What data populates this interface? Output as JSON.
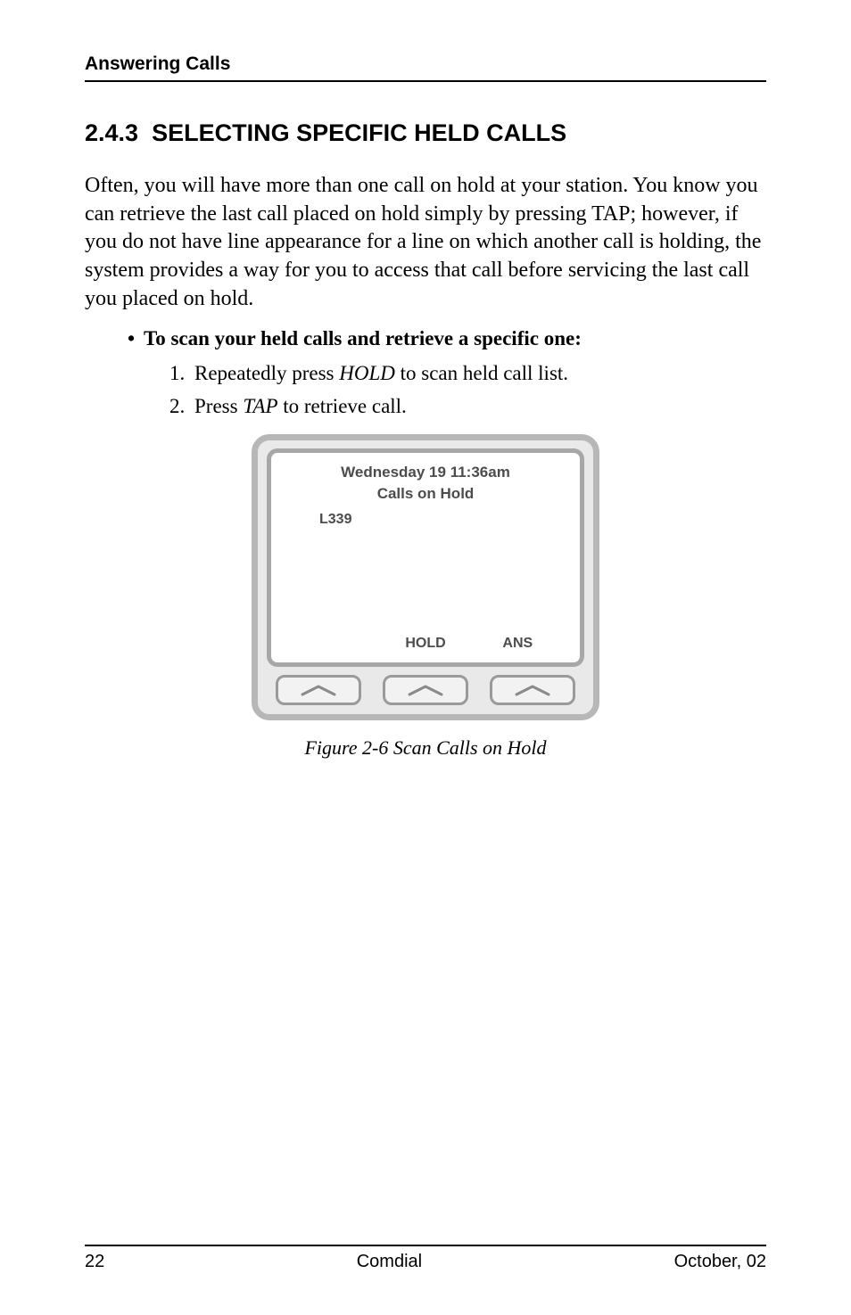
{
  "header": {
    "running_title": "Answering Calls"
  },
  "section": {
    "number": "2.4.3",
    "title": "SELECTING SPECIFIC HELD CALLS"
  },
  "paragraph": "Often, you will have more than one call on hold at your station. You know you can retrieve the last call placed on hold simply by pressing TAP; however, if you do not have line appearance for a line on which another call is holding, the system provides a way for you to access that call before servicing the last call you placed on hold.",
  "bullet": {
    "marker": "•",
    "text": "To scan your held calls and retrieve a specific one:"
  },
  "steps": [
    {
      "num": "1.",
      "pre": "Repeatedly press ",
      "em": "HOLD",
      "post": " to scan held call list."
    },
    {
      "num": "2.",
      "pre": "Press ",
      "em": "TAP",
      "post": " to retrieve call."
    }
  ],
  "phone": {
    "datetime": "Wednesday 19  11:36am",
    "status": "Calls on Hold",
    "line": "L339",
    "softkeys": {
      "left": "",
      "center": "HOLD",
      "right": "ANS"
    }
  },
  "figure_caption": "Figure 2-6  Scan Calls on Hold",
  "footer": {
    "page": "22",
    "center": "Comdial",
    "right": "October, 02"
  }
}
